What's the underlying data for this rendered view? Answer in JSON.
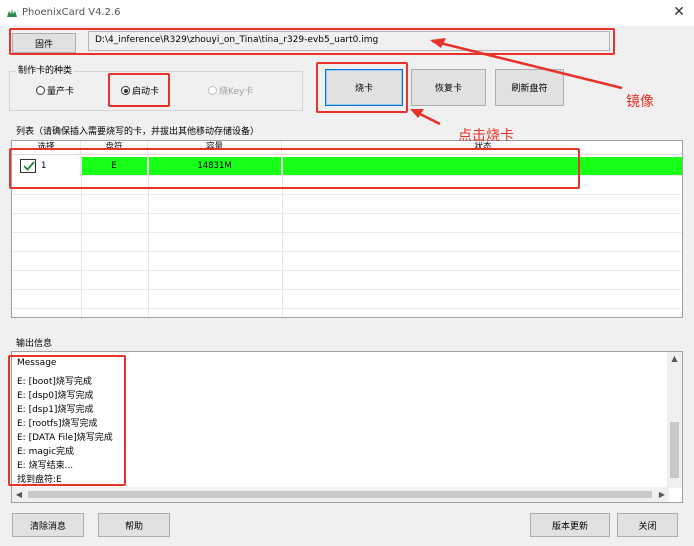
{
  "window": {
    "title": "PhoenixCard V4.2.6"
  },
  "firmware": {
    "button_label": "固件",
    "path": "D:\\4_inference\\R329\\zhouyi_on_Tina\\tina_r329-evb5_uart0.img"
  },
  "card_type": {
    "group_label": "制作卡的种类",
    "options": [
      {
        "label": "量产卡",
        "selected": false,
        "enabled": true
      },
      {
        "label": "启动卡",
        "selected": true,
        "enabled": true
      },
      {
        "label": "烧Key卡",
        "selected": false,
        "enabled": false
      }
    ]
  },
  "actions": {
    "burn": "烧卡",
    "restore": "恢复卡",
    "refresh": "刷新盘符"
  },
  "list": {
    "group_label": "列表（请确保插入需要烧写的卡，并拔出其他移动存储设备）",
    "columns": [
      "选择",
      "盘符",
      "容量",
      "状态"
    ],
    "rows": [
      {
        "index": "1",
        "drive": "E",
        "capacity": "14831M",
        "status": "",
        "checked": true
      }
    ]
  },
  "output": {
    "group_label": "输出信息",
    "lines": [
      "Message",
      "E: [boot]烧写完成",
      "E: [dsp0]烧写完成",
      "E: [dsp1]烧写完成",
      "E: [rootfs]烧写完成",
      "E: [DATA File]烧写完成",
      "E: magic完成",
      "E: 烧写结束...",
      "找到盘符:E"
    ]
  },
  "footer": {
    "clear": "清除消息",
    "help": "帮助",
    "update": "版本更新",
    "close": "关闭"
  },
  "annotations": {
    "mirror": "镜像",
    "click_burn": "点击烧卡"
  },
  "colors": {
    "highlight": "#18ff18",
    "annotation_red": "#e8332a",
    "accent_blue": "#0078d7"
  }
}
